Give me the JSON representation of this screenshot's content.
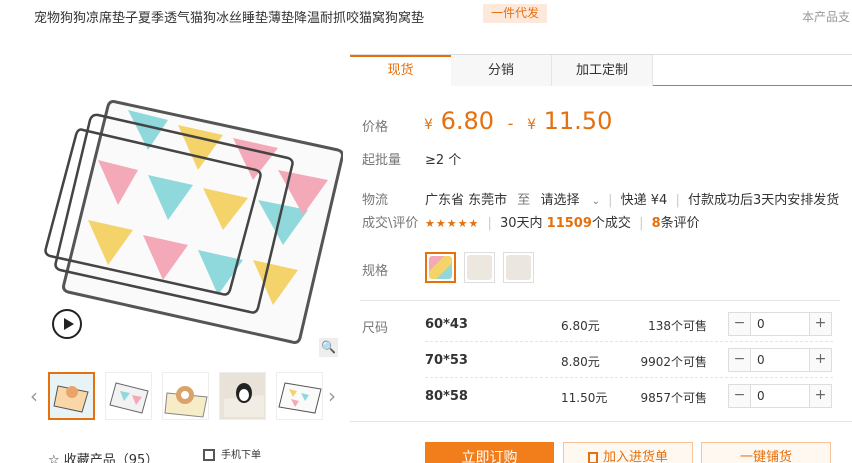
{
  "header": {
    "title": "宠物狗狗凉席垫子夏季透气猫狗冰丝睡垫薄垫降温耐抓咬猫窝狗窝垫",
    "badge": "一件代发",
    "support_text": "本产品支"
  },
  "gallery": {
    "zoom_icon": "🔍",
    "prev_arrow": "‹",
    "next_arrow": "›",
    "favorite_label": "☆ 收藏产品（95）",
    "mobile_label": "手机下单"
  },
  "tabs": [
    "现货",
    "分销",
    "加工定制"
  ],
  "price": {
    "label": "价格",
    "currency": "¥",
    "min": "6.80",
    "dash": "-",
    "max": "11.50"
  },
  "moq": {
    "label": "起批量",
    "value": "≥2 个"
  },
  "logistics": {
    "label": "物流",
    "origin": "广东省 东莞市",
    "to": "至",
    "dest": "请选择",
    "express": "快递 ¥4",
    "delivery": "付款成功后3天内安排发货"
  },
  "rating": {
    "label": "成交\\评价",
    "stars": "★★★★★",
    "period": "30天内",
    "deals": "11509",
    "deals_suffix": "个成交",
    "reviews": "8",
    "reviews_suffix": "条评价"
  },
  "spec": {
    "label": "规格"
  },
  "sizes": {
    "label": "尺码",
    "rows": [
      {
        "name": "60*43",
        "price": "6.80元",
        "stock": "138个可售",
        "qty": "0"
      },
      {
        "name": "70*53",
        "price": "8.80元",
        "stock": "9902个可售",
        "qty": "0"
      },
      {
        "name": "80*58",
        "price": "11.50元",
        "stock": "9857个可售",
        "qty": "0"
      }
    ]
  },
  "actions": {
    "buy": "立即订购",
    "add_list": "加入进货单",
    "distribute": "一键铺货"
  },
  "colors": {
    "accent": "#e4700e",
    "button_orange": "#f27e1b",
    "badge_bg": "#fde8dc"
  }
}
